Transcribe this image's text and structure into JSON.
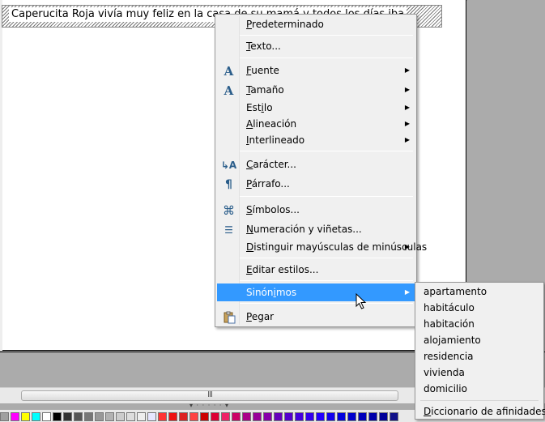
{
  "document": {
    "text_line": "Caperucita Roja vivía muy feliz en la casa de su mamá y todos los días iba"
  },
  "context_menu": {
    "items": [
      {
        "label": "Predeterminado",
        "icon": "",
        "submenu": false
      },
      {
        "label": "Texto...",
        "icon": "",
        "submenu": false
      },
      {
        "label": "Fuente",
        "icon": "font-icon",
        "submenu": true
      },
      {
        "label": "Tamaño",
        "icon": "font-size-icon",
        "submenu": true
      },
      {
        "label": "Estilo",
        "icon": "",
        "submenu": true
      },
      {
        "label": "Alineación",
        "icon": "",
        "submenu": true
      },
      {
        "label": "Interlineado",
        "icon": "",
        "submenu": true
      },
      {
        "label": "Carácter...",
        "icon": "character-icon",
        "submenu": false
      },
      {
        "label": "Párrafo...",
        "icon": "paragraph-icon",
        "submenu": false
      },
      {
        "label": "Símbolos...",
        "icon": "symbols-icon",
        "submenu": false
      },
      {
        "label": "Numeración y viñetas...",
        "icon": "bullets-icon",
        "submenu": false
      },
      {
        "label": "Distinguir mayúsculas de minúsculas",
        "icon": "",
        "submenu": true
      },
      {
        "label": "Editar estilos...",
        "icon": "",
        "submenu": false
      },
      {
        "label": "Sinónimos",
        "icon": "",
        "submenu": true,
        "highlighted": true
      },
      {
        "label": "Pegar",
        "icon": "paste-icon",
        "submenu": false
      }
    ]
  },
  "synonyms_submenu": {
    "items": [
      "apartamento",
      "habitáculo",
      "habitación",
      "alojamiento",
      "residencia",
      "vivienda",
      "domicilio"
    ],
    "footer": "Diccionario de afinidades"
  },
  "scrollbar": {
    "grip": "III"
  },
  "palette": {
    "colors": [
      "#a0a0a0",
      "#ff00ff",
      "#ffff00",
      "#00ffff",
      "#ffffff",
      "#000000",
      "#333333",
      "#555555",
      "#777777",
      "#999999",
      "#b2b2b2",
      "#cccccc",
      "#dddddd",
      "#eeeeee",
      "#e6e6ff",
      "#ff3333",
      "#ee1111",
      "#dd2222",
      "#ff4444",
      "#cc0000",
      "#dd0033",
      "#ee2266",
      "#cc0066",
      "#aa0088",
      "#990099",
      "#8800aa",
      "#6600bb",
      "#5500cc",
      "#4400dd",
      "#3300ee",
      "#2200ff",
      "#1100ee",
      "#0000dd",
      "#0000cc",
      "#0000bb",
      "#0000aa",
      "#000099",
      "#111188"
    ]
  },
  "colors": {
    "highlight": "#3399ff",
    "menu_bg": "#f0f0f0"
  }
}
